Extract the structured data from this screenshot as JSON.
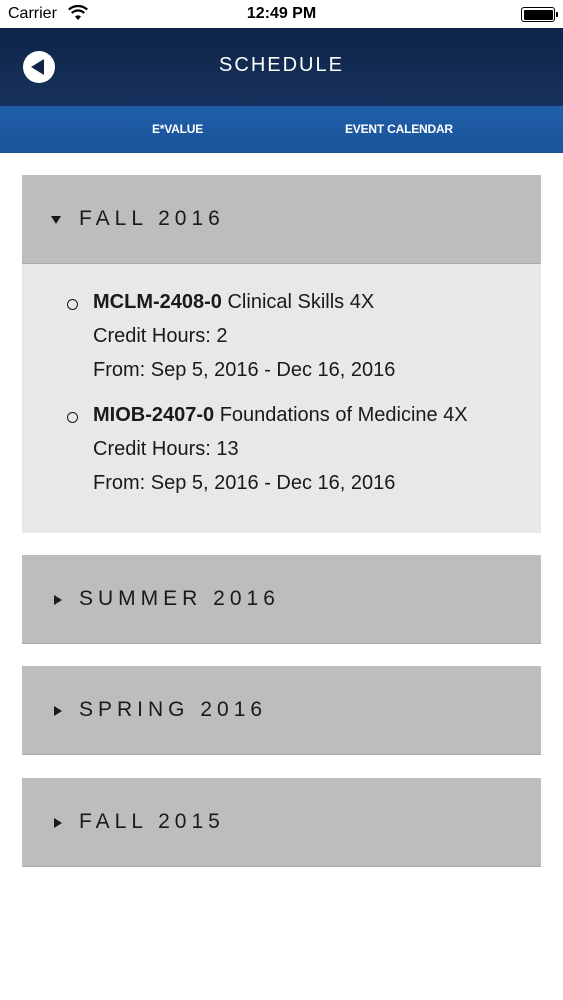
{
  "status_bar": {
    "carrier": "Carrier",
    "time": "12:49 PM"
  },
  "header": {
    "title": "SCHEDULE",
    "back_icon": "back-arrow-circle-icon"
  },
  "tabs": [
    {
      "label": "E*VALUE"
    },
    {
      "label": "EVENT CALENDAR"
    }
  ],
  "terms": [
    {
      "label": "FALL 2016",
      "expanded": true,
      "courses": [
        {
          "code": "MCLM-2408-0",
          "name": "Clinical Skills 4X",
          "credit_hours": "Credit Hours: 2",
          "dates": "From: Sep 5, 2016 - Dec 16, 2016"
        },
        {
          "code": "MIOB-2407-0",
          "name": "Foundations of Medicine 4X",
          "credit_hours": "Credit Hours: 13",
          "dates": "From: Sep 5, 2016 - Dec 16, 2016"
        }
      ]
    },
    {
      "label": "SUMMER 2016",
      "expanded": false
    },
    {
      "label": "SPRING 2016",
      "expanded": false
    },
    {
      "label": "FALL 2015",
      "expanded": false
    }
  ],
  "colors": {
    "header_dark": "#0e2447",
    "tab_blue": "#1f5fa8",
    "section_header": "#bdbdbf",
    "section_body": "#e8e8ea"
  }
}
